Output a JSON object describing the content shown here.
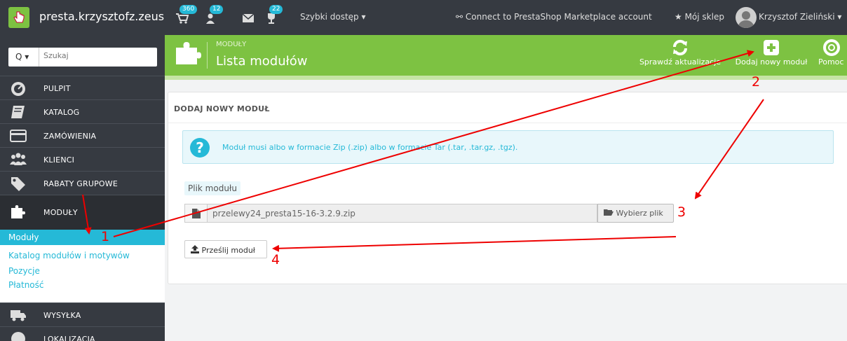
{
  "topbar": {
    "shop_name": "presta.krzysztofz.zeus",
    "notifications": [
      {
        "icon": "cart-icon",
        "count": "360"
      },
      {
        "icon": "users-icon",
        "count": "12"
      },
      {
        "icon": "envelope-icon",
        "count": ""
      },
      {
        "icon": "trophy-icon",
        "count": "22"
      }
    ],
    "quick_access": "Szybki dostęp ▾",
    "connect": "Connect to PrestaShop Marketplace account",
    "my_shop": "Mój sklep",
    "user": "Krzysztof Zieliński ▾"
  },
  "search": {
    "button": "Q ▾",
    "placeholder": "Szukaj"
  },
  "sidebar": {
    "items": [
      {
        "label": "PULPIT",
        "icon": "dashboard-icon"
      },
      {
        "label": "KATALOG",
        "icon": "book-icon"
      },
      {
        "label": "ZAMÓWIENIA",
        "icon": "credit-card-icon"
      },
      {
        "label": "KLIENCI",
        "icon": "group-icon"
      },
      {
        "label": "RABATY GRUPOWE",
        "icon": "tags-icon"
      },
      {
        "label": "MODUŁY",
        "icon": "puzzle-icon"
      }
    ],
    "subitems": [
      "Moduły",
      "Katalog modułów i motywów",
      "Pozycje",
      "Płatność"
    ],
    "items_after": [
      {
        "label": "WYSYŁKA",
        "icon": "truck-icon"
      },
      {
        "label": "LOKALIZACJA",
        "icon": "globe-icon"
      }
    ]
  },
  "header": {
    "breadcrumb": "MODUŁY",
    "title": "Lista modułów",
    "toolbar": [
      {
        "label": "Sprawdź aktualizacje",
        "icon": "refresh-icon"
      },
      {
        "label": "Dodaj nowy moduł",
        "icon": "plus-square-icon"
      },
      {
        "label": "Pomoc",
        "icon": "lifebuoy-icon"
      }
    ]
  },
  "panel": {
    "title": "DODAJ NOWY MODUŁ",
    "info": "Moduł musi albo w formacie Zip (.zip) albo w formacie Tar (.tar, .tar.gz, .tgz).",
    "file_label": "Plik modułu",
    "file_value": "przelewy24_presta15-16-3.2.9.zip",
    "choose_button": "Wybierz plik",
    "upload_button": "Prześlij moduł"
  },
  "annotations": {
    "n1": "1",
    "n2": "2",
    "n3": "3",
    "n4": "4"
  },
  "colors": {
    "accent": "#7dc242",
    "info": "#25b9d7",
    "dark": "#363a41",
    "annotation": "#ee0000"
  }
}
